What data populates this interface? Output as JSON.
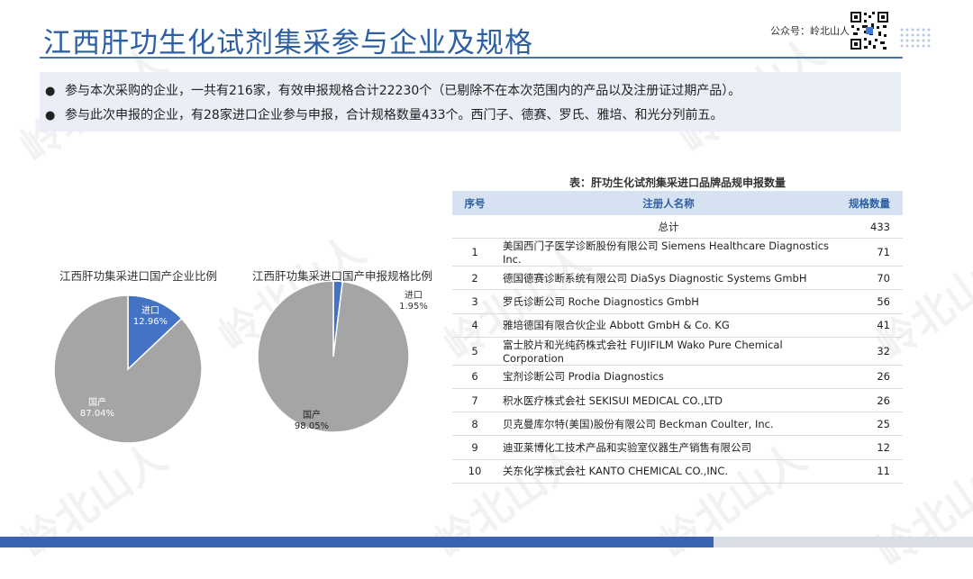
{
  "header": {
    "title": "江西肝功生化试剂集采参与企业及规格",
    "brand_label": "公众号：岭北山人",
    "watermark_text": "岭北山人"
  },
  "summary": {
    "bullets": [
      "参与本次采购的企业，一共有216家，有效申报规格合计22230个（已剔除不在本次范围内的产品以及注册证过期产品）。",
      "参与此次申报的企业，有28家进口企业参与申报，合计规格数量433个。西门子、德赛、罗氏、雅培、和光分列前五。"
    ]
  },
  "colors": {
    "accent": "#2c5fa3",
    "import": "#4472c4",
    "domestic": "#a5a5a5"
  },
  "chart_data": [
    {
      "type": "pie",
      "title": "江西肝功集采进口国产企业比例",
      "labels": [
        "进口",
        "国产"
      ],
      "values": [
        12.96,
        87.04
      ],
      "display": [
        "12.96%",
        "87.04%"
      ]
    },
    {
      "type": "pie",
      "title": "江西肝功集采进口国产申报规格比例",
      "labels": [
        "进口",
        "国产"
      ],
      "values": [
        1.95,
        98.05
      ],
      "display": [
        "1.95%",
        "98.05%"
      ]
    }
  ],
  "table": {
    "caption": "表：肝功生化试剂集采进口品牌品规申报数量",
    "headers": [
      "序号",
      "注册人名称",
      "规格数量"
    ],
    "total_label": "总计",
    "total_value": "433",
    "rows": [
      {
        "no": "1",
        "name": "美国西门子医学诊断股份有限公司 Siemens Healthcare Diagnostics Inc.",
        "count": "71"
      },
      {
        "no": "2",
        "name": "德国德赛诊断系统有限公司 DiaSys Diagnostic Systems GmbH",
        "count": "70"
      },
      {
        "no": "3",
        "name": "罗氏诊断公司 Roche Diagnostics GmbH",
        "count": "56"
      },
      {
        "no": "4",
        "name": "雅培德国有限合伙企业 Abbott GmbH & Co. KG",
        "count": "41"
      },
      {
        "no": "5",
        "name": "富士胶片和光纯药株式会社 FUJIFILM Wako Pure Chemical Corporation",
        "count": "32"
      },
      {
        "no": "6",
        "name": "宝剂诊断公司 Prodia Diagnostics",
        "count": "26"
      },
      {
        "no": "7",
        "name": "积水医疗株式会社 SEKISUI MEDICAL CO.,LTD",
        "count": "26"
      },
      {
        "no": "8",
        "name": "贝克曼库尔特(美国)股份有限公司 Beckman Coulter, Inc.",
        "count": "25"
      },
      {
        "no": "9",
        "name": "迪亚莱博化工技术产品和实验室仪器生产销售有限公司",
        "count": "12"
      },
      {
        "no": "10",
        "name": "关东化学株式会社 KANTO CHEMICAL CO.,INC.",
        "count": "11"
      }
    ]
  }
}
